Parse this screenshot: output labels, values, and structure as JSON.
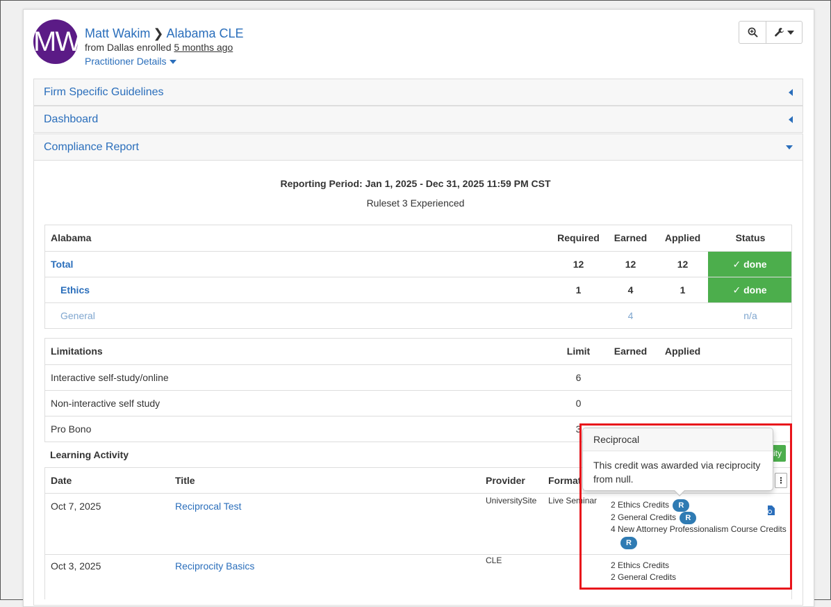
{
  "header": {
    "avatar_initials": "MW",
    "user_name": "Matt Wakim",
    "program": "Alabama CLE",
    "from_text": "from Dallas enrolled",
    "enrolled_ago": "5 months ago",
    "details_link": "Practitioner Details"
  },
  "panels": {
    "firm": "Firm Specific Guidelines",
    "dashboard": "Dashboard",
    "compliance": "Compliance Report"
  },
  "report": {
    "period": "Reporting Period: Jan 1, 2025 - Dec 31, 2025 11:59 PM CST",
    "ruleset": "Ruleset 3 Experienced"
  },
  "requirements": {
    "headers": [
      "Alabama",
      "Required",
      "Earned",
      "Applied",
      "Status"
    ],
    "rows": [
      {
        "name": "Total",
        "required": "12",
        "earned": "12",
        "applied": "12",
        "status": "✓ done"
      },
      {
        "name": "Ethics",
        "required": "1",
        "earned": "4",
        "applied": "1",
        "status": "✓ done"
      },
      {
        "name": "General",
        "required": "",
        "earned": "4",
        "applied": "",
        "status": "n/a"
      }
    ]
  },
  "limitations": {
    "headers": [
      "Limitations",
      "Limit",
      "Earned",
      "Applied"
    ],
    "rows": [
      {
        "name": "Interactive self-study/online",
        "limit": "6"
      },
      {
        "name": "Non-interactive self study",
        "limit": "0"
      },
      {
        "name": "Pro Bono",
        "limit": "3"
      }
    ]
  },
  "activity": {
    "title": "Learning Activity",
    "add_label": "ity",
    "headers": [
      "Date",
      "Title",
      "Provider",
      "Format"
    ],
    "rows": [
      {
        "date": "Oct 7, 2025",
        "title": "Reciprocal Test",
        "provider": "UniversitySite",
        "format": "Live Seminar",
        "credits": [
          "2 Ethics Credits",
          "2 General Credits",
          "4 New Attorney Professionalism Course Credits"
        ]
      },
      {
        "date": "Oct 3, 2025",
        "title": "Reciprocity Basics",
        "provider": "CLE",
        "format": "",
        "credits": [
          "2 Ethics Credits",
          "2 General Credits"
        ]
      }
    ],
    "badge": "R"
  },
  "popover": {
    "title": "Reciprocal",
    "body": "This credit was awarded via reciprocity from null."
  },
  "colors": {
    "link": "#2a6ebb",
    "success": "#4cae4c",
    "avatar": "#5b1b86",
    "badge": "#2f7bb3",
    "highlight": "#e8141b"
  }
}
